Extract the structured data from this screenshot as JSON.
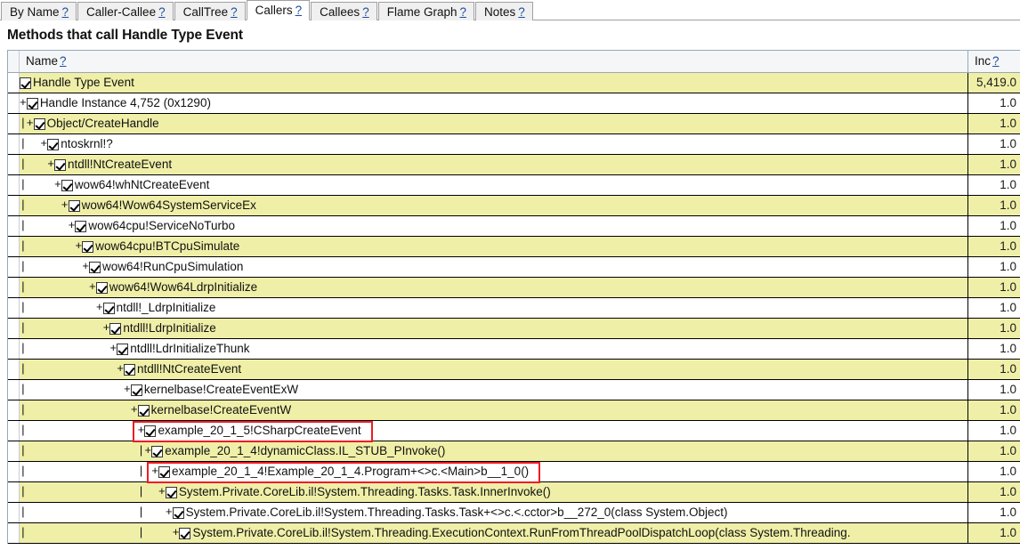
{
  "tabs": [
    {
      "label": "By Name",
      "help": "?",
      "active": false
    },
    {
      "label": "Caller-Callee",
      "help": "?",
      "active": false
    },
    {
      "label": "CallTree",
      "help": "?",
      "active": false
    },
    {
      "label": "Callers",
      "help": "?",
      "active": true
    },
    {
      "label": "Callees",
      "help": "?",
      "active": false
    },
    {
      "label": "Flame Graph",
      "help": "?",
      "active": false
    },
    {
      "label": "Notes",
      "help": "?",
      "active": false
    }
  ],
  "page_title": "Methods that call Handle Type Event",
  "grid": {
    "columns": [
      {
        "key": "name",
        "label": "Name",
        "help": "?"
      },
      {
        "key": "inc",
        "label": "Inc",
        "help": "?"
      }
    ],
    "rows": [
      {
        "prefix": "",
        "checked": true,
        "label": "Handle Type Event",
        "inc": "5,419.0",
        "alt": true,
        "highlight": false
      },
      {
        "prefix": "+",
        "checked": true,
        "label": "Handle Instance 4,752 (0x1290)",
        "inc": "1.0",
        "alt": false,
        "highlight": false
      },
      {
        "prefix": "|+",
        "checked": true,
        "label": "Object/CreateHandle",
        "inc": "1.0",
        "alt": true,
        "highlight": false
      },
      {
        "prefix": "|  +",
        "checked": true,
        "label": "ntoskrnl!?",
        "inc": "1.0",
        "alt": false,
        "highlight": false
      },
      {
        "prefix": "|   +",
        "checked": true,
        "label": "ntdll!NtCreateEvent",
        "inc": "1.0",
        "alt": true,
        "highlight": false
      },
      {
        "prefix": "|    +",
        "checked": true,
        "label": "wow64!whNtCreateEvent",
        "inc": "1.0",
        "alt": false,
        "highlight": false
      },
      {
        "prefix": "|     +",
        "checked": true,
        "label": "wow64!Wow64SystemServiceEx",
        "inc": "1.0",
        "alt": true,
        "highlight": false
      },
      {
        "prefix": "|      +",
        "checked": true,
        "label": "wow64cpu!ServiceNoTurbo",
        "inc": "1.0",
        "alt": false,
        "highlight": false
      },
      {
        "prefix": "|       +",
        "checked": true,
        "label": "wow64cpu!BTCpuSimulate",
        "inc": "1.0",
        "alt": true,
        "highlight": false
      },
      {
        "prefix": "|        +",
        "checked": true,
        "label": "wow64!RunCpuSimulation",
        "inc": "1.0",
        "alt": false,
        "highlight": false
      },
      {
        "prefix": "|         +",
        "checked": true,
        "label": "wow64!Wow64LdrpInitialize",
        "inc": "1.0",
        "alt": true,
        "highlight": false
      },
      {
        "prefix": "|          +",
        "checked": true,
        "label": "ntdll!_LdrpInitialize",
        "inc": "1.0",
        "alt": false,
        "highlight": false
      },
      {
        "prefix": "|           +",
        "checked": true,
        "label": "ntdll!LdrpInitialize",
        "inc": "1.0",
        "alt": true,
        "highlight": false
      },
      {
        "prefix": "|            +",
        "checked": true,
        "label": "ntdll!LdrInitializeThunk",
        "inc": "1.0",
        "alt": false,
        "highlight": false
      },
      {
        "prefix": "|             +",
        "checked": true,
        "label": "ntdll!NtCreateEvent",
        "inc": "1.0",
        "alt": true,
        "highlight": false
      },
      {
        "prefix": "|              +",
        "checked": true,
        "label": "kernelbase!CreateEventExW",
        "inc": "1.0",
        "alt": false,
        "highlight": false
      },
      {
        "prefix": "|               +",
        "checked": true,
        "label": "kernelbase!CreateEventW",
        "inc": "1.0",
        "alt": true,
        "highlight": false
      },
      {
        "prefix": "|                +",
        "checked": true,
        "label": "example_20_1_5!CSharpCreateEvent",
        "inc": "1.0",
        "alt": false,
        "highlight": true
      },
      {
        "prefix": "|                |+",
        "checked": true,
        "label": "example_20_1_4!dynamicClass.IL_STUB_PInvoke()",
        "inc": "1.0",
        "alt": true,
        "highlight": false
      },
      {
        "prefix": "|                | +",
        "checked": true,
        "label": "example_20_1_4!Example_20_1_4.Program+<>c.<Main>b__1_0()",
        "inc": "1.0",
        "alt": false,
        "highlight": true
      },
      {
        "prefix": "|                |  +",
        "checked": true,
        "label": "System.Private.CoreLib.il!System.Threading.Tasks.Task.InnerInvoke()",
        "inc": "1.0",
        "alt": true,
        "highlight": false
      },
      {
        "prefix": "|                |   +",
        "checked": true,
        "label": "System.Private.CoreLib.il!System.Threading.Tasks.Task+<>c.<.cctor>b__272_0(class System.Object)",
        "inc": "1.0",
        "alt": false,
        "highlight": false
      },
      {
        "prefix": "|                |    +",
        "checked": true,
        "label": "System.Private.CoreLib.il!System.Threading.ExecutionContext.RunFromThreadPoolDispatchLoop(class System.Threading.",
        "inc": "1.0",
        "alt": true,
        "highlight": false
      }
    ]
  },
  "colors": {
    "row_highlight_yellow": "#EFEFA8",
    "annotation_red": "#EE1C25",
    "link_blue": "#1A4FA0",
    "grid_border": "#9AA7B8"
  }
}
